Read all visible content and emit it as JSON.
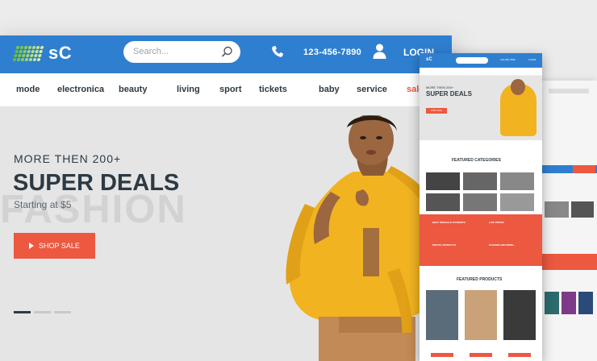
{
  "header": {
    "brand": "sC",
    "search_placeholder": "Search...",
    "phone": "123-456-7890",
    "login": "LOGIN"
  },
  "nav": [
    "mode",
    "electronica",
    "beauty",
    "living",
    "sport",
    "tickets",
    "baby",
    "service",
    "sale"
  ],
  "hero": {
    "kicker": "MORE THEN 200+",
    "title": "SUPER DEALS",
    "subtitle": "Starting at $5",
    "watermark": "FASHION",
    "cta": "SHOP SALE"
  },
  "mobile": {
    "kicker": "MORE THEN 200+",
    "title": "SUPER DEALS",
    "cta": "SHOP SALE",
    "featured_categories": "FEATURED CATEGORIES",
    "featured_products": "FEATURED PRODUCTS",
    "features": [
      "BEST WEBSALE PAYMENTS",
      "LOW PRICES",
      "DIGITAL PRODUCTS",
      "FASHION AND MORE..."
    ]
  },
  "colors": {
    "header_blue": "#2f7fd1",
    "accent": "#ec5840",
    "text_dark": "#2d3a44",
    "hoodie_yellow": "#f2b320"
  }
}
